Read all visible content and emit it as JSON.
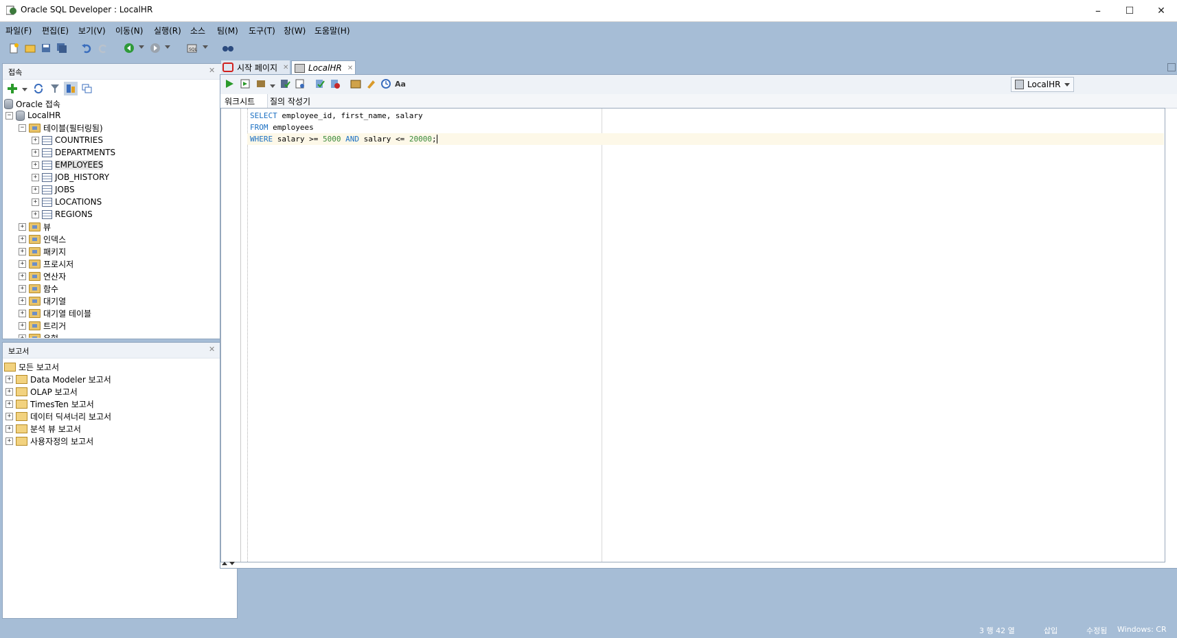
{
  "window": {
    "title": "Oracle SQL Developer : LocalHR",
    "minimize": "–",
    "maximize": "☐",
    "close": "✕"
  },
  "menu": [
    "파일(F)",
    "편집(E)",
    "보기(V)",
    "이동(N)",
    "실행(R)",
    "소스",
    "팀(M)",
    "도구(T)",
    "창(W)",
    "도움말(H)"
  ],
  "connections_panel": {
    "title": "접속",
    "tree": {
      "root": "Oracle 접속",
      "connection": "LocalHR",
      "tables_folder": "테이블(필터링됨)",
      "tables": [
        "COUNTRIES",
        "DEPARTMENTS",
        "EMPLOYEES",
        "JOB_HISTORY",
        "JOBS",
        "LOCATIONS",
        "REGIONS"
      ],
      "folders": [
        "뷰",
        "인덱스",
        "패키지",
        "프로시저",
        "연산자",
        "함수",
        "대기열",
        "대기열 테이블",
        "트리거",
        "유형"
      ]
    }
  },
  "reports_panel": {
    "title": "보고서",
    "root": "모든 보고서",
    "items": [
      "Data Modeler 보고서",
      "OLAP 보고서",
      "TimesTen 보고서",
      "데이터 딕셔너리 보고서",
      "분석 뷰 보고서",
      "사용자정의 보고서"
    ]
  },
  "editor": {
    "tabs": [
      "시작 페이지",
      "LocalHR"
    ],
    "connection_selector": "LocalHR",
    "subtabs": [
      "워크시트",
      "질의 작성기"
    ],
    "code": {
      "line1": {
        "kw1": "SELECT",
        "rest": " employee_id, first_name, salary"
      },
      "line2": {
        "kw1": "FROM",
        "rest": " employees"
      },
      "line3": {
        "kw1": "WHERE",
        "a": " salary >= ",
        "n1": "5000",
        "kw2": " AND",
        "b": " salary <= ",
        "n2": "20000",
        "c": ";"
      }
    }
  },
  "status": {
    "position": "3 행 42 열",
    "mode": "삽입",
    "modified": "수정됨",
    "eol": "Windows: CR"
  },
  "colors": {
    "chrome": "#a6bdd6",
    "keyword": "#1a6fc2",
    "number": "#3a8a3a",
    "current_line": "#fdf8e8"
  }
}
